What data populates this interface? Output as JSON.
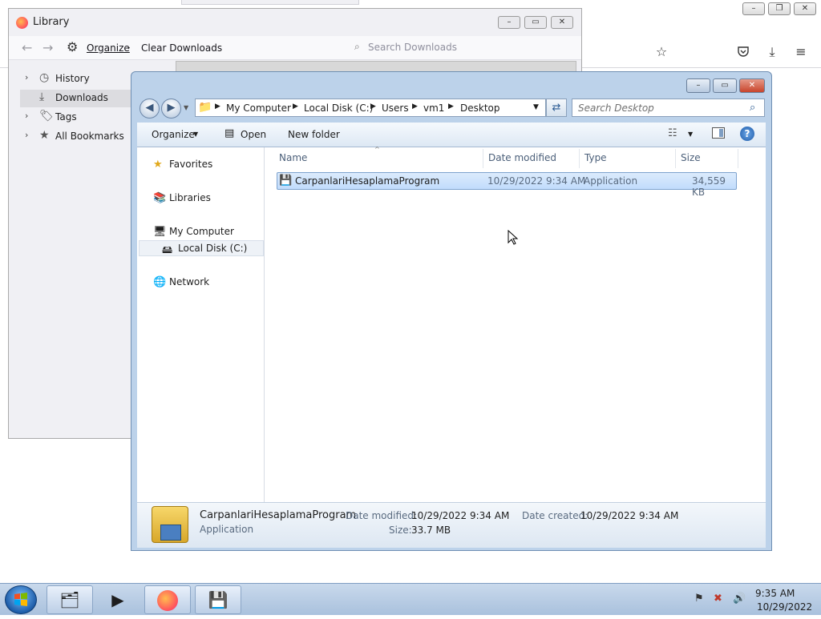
{
  "firefox": {
    "controls": {
      "minimize": "–",
      "restore": "❐",
      "close": "✕"
    },
    "toolbar_icons": [
      "star-icon",
      "pocket-icon",
      "download-icon",
      "menu-icon"
    ]
  },
  "library": {
    "title": "Library",
    "controls": {
      "minimize": "–",
      "maximize": "▭",
      "close": "✕"
    },
    "toolbar": {
      "organize": "Organize",
      "clear": "Clear Downloads"
    },
    "search_placeholder": "Search Downloads",
    "sidebar": [
      {
        "label": "History",
        "icon": "clock-icon",
        "expandable": true
      },
      {
        "label": "Downloads",
        "icon": "download-icon",
        "expandable": false,
        "selected": true
      },
      {
        "label": "Tags",
        "icon": "tag-icon",
        "expandable": true
      },
      {
        "label": "All Bookmarks",
        "icon": "star-icon",
        "expandable": true
      }
    ]
  },
  "explorer": {
    "controls": {
      "minimize": "–",
      "maximize": "▭",
      "close": "✕"
    },
    "breadcrumb": [
      "My Computer",
      "Local Disk (C:)",
      "Users",
      "vm1",
      "Desktop"
    ],
    "search_placeholder": "Search Desktop",
    "commands": {
      "organize": "Organize",
      "open": "Open",
      "new_folder": "New folder"
    },
    "nav": {
      "favorites": "Favorites",
      "libraries": "Libraries",
      "computer": "My Computer",
      "local_disk": "Local Disk (C:)",
      "network": "Network"
    },
    "columns": {
      "name": "Name",
      "date": "Date modified",
      "type": "Type",
      "size": "Size"
    },
    "files": [
      {
        "name": "CarpanlariHesaplamaProgram",
        "date": "10/29/2022 9:34 AM",
        "type": "Application",
        "size": "34,559 KB"
      }
    ],
    "details": {
      "name": "CarpanlariHesaplamaProgram",
      "type": "Application",
      "date_modified_label": "Date modified:",
      "date_modified": "10/29/2022 9:34 AM",
      "size_label": "Size:",
      "size": "33.7 MB",
      "date_created_label": "Date created:",
      "date_created": "10/29/2022 9:34 AM"
    }
  },
  "taskbar": {
    "time": "9:35 AM",
    "date": "10/29/2022",
    "apps": [
      "explorer-icon",
      "media-player-icon",
      "firefox-icon",
      "program-icon"
    ]
  }
}
